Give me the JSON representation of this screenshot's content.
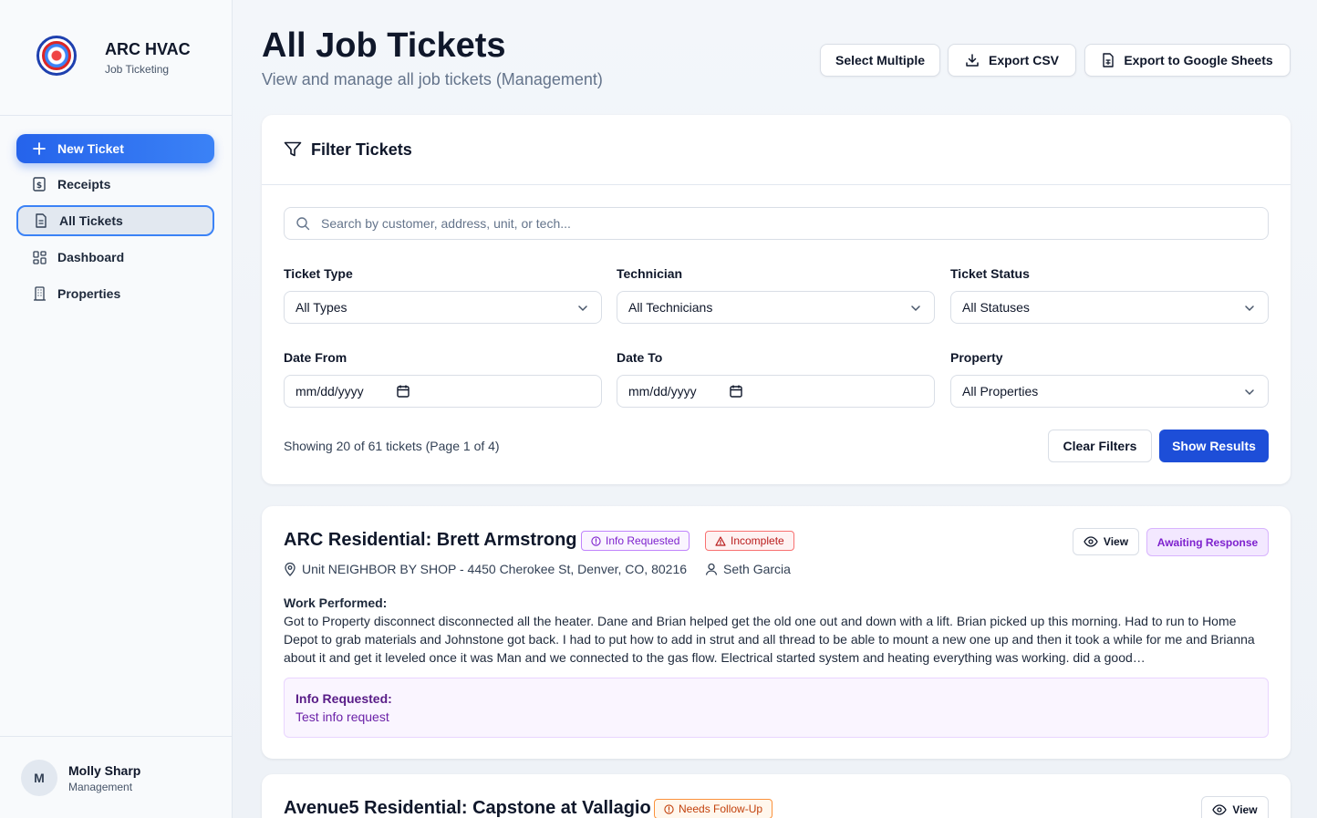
{
  "brand": {
    "name": "ARC HVAC",
    "subtitle": "Job Ticketing"
  },
  "nav": {
    "new_ticket": "New Ticket",
    "receipts": "Receipts",
    "all_tickets": "All Tickets",
    "dashboard": "Dashboard",
    "properties": "Properties"
  },
  "user": {
    "initial": "M",
    "name": "Molly Sharp",
    "role": "Management"
  },
  "header": {
    "title": "All Job Tickets",
    "subtitle": "View and manage all job tickets (Management)",
    "select_multiple": "Select Multiple",
    "export_csv": "Export CSV",
    "export_sheets": "Export to Google Sheets"
  },
  "filters": {
    "title": "Filter Tickets",
    "search_placeholder": "Search by customer, address, unit, or tech...",
    "ticket_type_label": "Ticket Type",
    "ticket_type_value": "All Types",
    "technician_label": "Technician",
    "technician_value": "All Technicians",
    "status_label": "Ticket Status",
    "status_value": "All Statuses",
    "date_from_label": "Date From",
    "date_from_value": "mm/dd/yyyy",
    "date_to_label": "Date To",
    "date_to_value": "mm/dd/yyyy",
    "property_label": "Property",
    "property_value": "All Properties",
    "showing": "Showing 20 of 61 tickets (Page 1 of 4)",
    "clear": "Clear Filters",
    "show_results": "Show Results"
  },
  "tickets": [
    {
      "title": "ARC Residential: Brett Armstrong",
      "badges": [
        "Info Requested",
        "Incomplete"
      ],
      "address": "Unit NEIGHBOR BY SHOP - 4450 Cherokee St, Denver, CO, 80216",
      "technician": "Seth Garcia",
      "view": "View",
      "status": "Awaiting Response",
      "work_label": "Work Performed:",
      "work_text": "Got to Property disconnect disconnected all the heater. Dane and Brian helped get the old one out and down with a lift. Brian picked up this morning. Had to run to Home Depot to grab materials and Johnstone got back. I had to put how to add in strut and all thread to be able to mount a new one up and then it took a while for me and Brianna about it and get it leveled once it was Man and we connected to the gas flow. Electrical started system and heating everything was working. did a good…",
      "info_label": "Info Requested:",
      "info_text": "Test info request"
    },
    {
      "title": "Avenue5 Residential: Capstone at Vallagio",
      "badges": [
        "Needs Follow-Up"
      ],
      "view": "View"
    }
  ]
}
